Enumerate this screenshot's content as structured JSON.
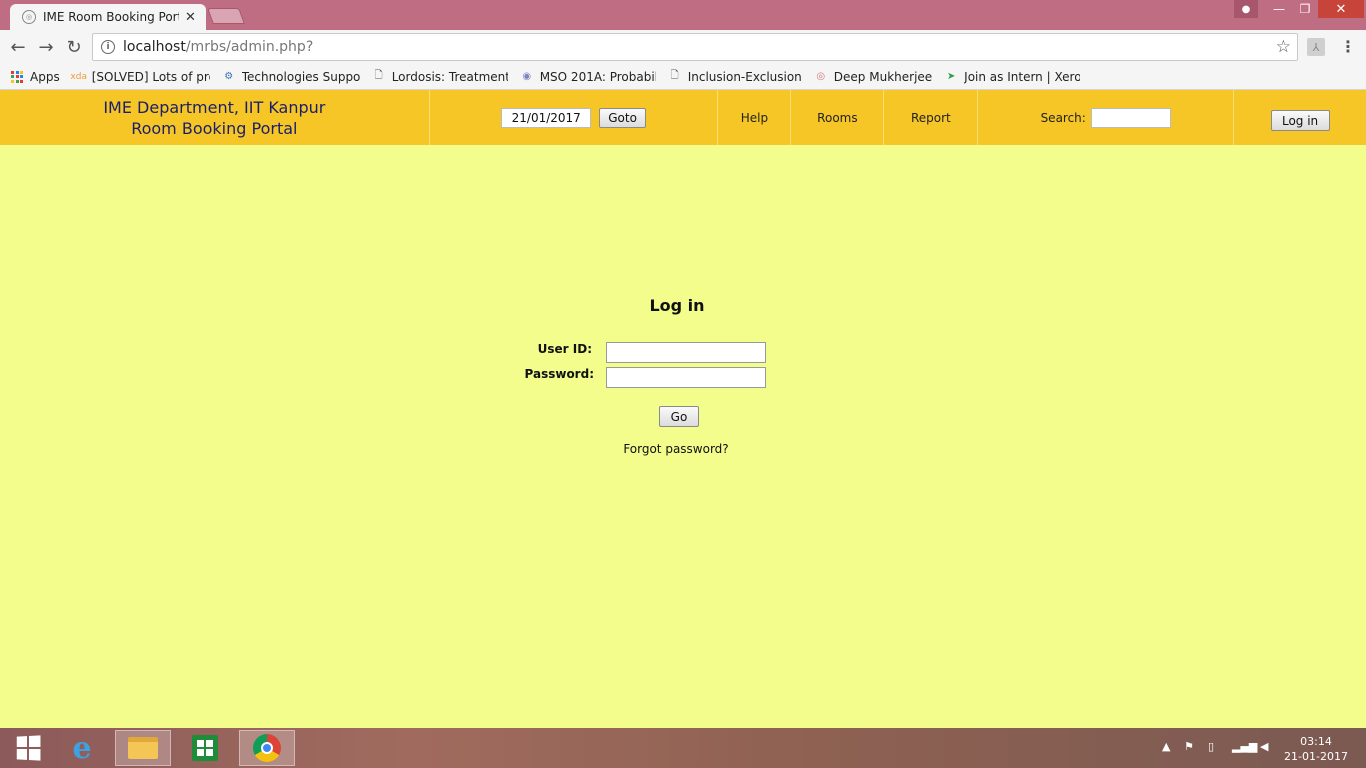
{
  "browser": {
    "tab": {
      "title": "IME Room Booking Porta",
      "close": "✕"
    },
    "address": {
      "host": "localhost",
      "path": "/mrbs/admin.php?"
    },
    "bookmarks": [
      {
        "label": "Apps",
        "icon": "apps-grid-icon"
      },
      {
        "label": "[SOLVED] Lots of prob",
        "icon": "xda-icon"
      },
      {
        "label": "Technologies Support",
        "icon": "tech-icon"
      },
      {
        "label": "Lordosis: Treatment, E",
        "icon": "page-icon"
      },
      {
        "label": "MSO 201A: Probabilit",
        "icon": "course-icon"
      },
      {
        "label": "Inclusion-Exclusion",
        "icon": "page-icon"
      },
      {
        "label": "Deep Mukherjee",
        "icon": "profile-icon"
      },
      {
        "label": "Join as Intern | Xerox I",
        "icon": "xerox-icon"
      }
    ]
  },
  "header": {
    "title_line1": "IME Department, IIT Kanpur",
    "title_line2": "Room Booking Portal",
    "date_value": "21/01/2017",
    "goto_label": "Goto",
    "help_label": "Help",
    "rooms_label": "Rooms",
    "report_label": "Report",
    "search_label": "Search:",
    "login_label": "Log in"
  },
  "login_form": {
    "title": "Log in",
    "userid_label": "User ID:",
    "password_label": "Password:",
    "go_label": "Go",
    "forgot_label": "Forgot password?"
  },
  "taskbar": {
    "time": "03:14",
    "date": "21-01-2017"
  },
  "colors": {
    "header_bg": "#f6c526",
    "page_bg": "#f2fd8c",
    "title_text": "#1b1f6b",
    "browser_frame": "#bf6d83"
  }
}
